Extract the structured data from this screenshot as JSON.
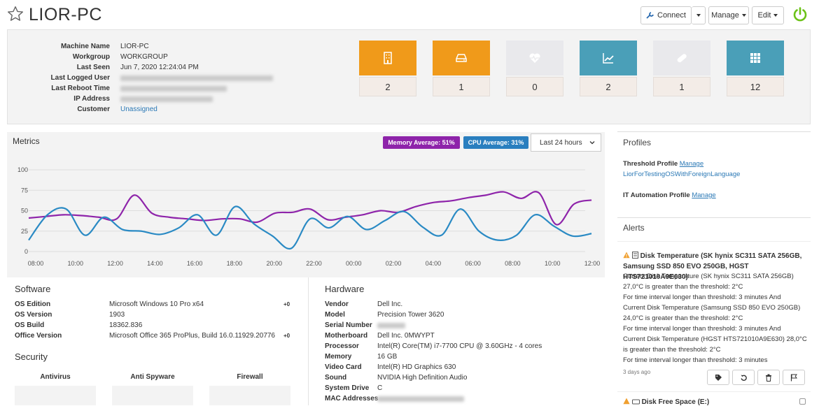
{
  "header": {
    "title": "LIOR-PC",
    "connect_label": "Connect",
    "manage_label": "Manage",
    "edit_label": "Edit"
  },
  "machine": {
    "rows": [
      {
        "label": "Machine Name",
        "value": "LIOR-PC"
      },
      {
        "label": "Workgroup",
        "value": "WORKGROUP"
      },
      {
        "label": "Last Seen",
        "value": "Jun 7, 2020 12:24:04 PM"
      },
      {
        "label": "Last Logged User",
        "value": ""
      },
      {
        "label": "Last Reboot Time",
        "value": ""
      },
      {
        "label": "IP Address",
        "value": ""
      },
      {
        "label": "Customer",
        "value": "Unassigned"
      }
    ]
  },
  "tiles": [
    {
      "icon": "building-icon",
      "count": "2",
      "color": "#f09a1a"
    },
    {
      "icon": "drive-icon",
      "count": "1",
      "color": "#f09a1a"
    },
    {
      "icon": "heartbeat-icon",
      "count": "0",
      "color": "#e9e9ec"
    },
    {
      "icon": "trend-chart-icon",
      "count": "2",
      "color": "#4a9fb8"
    },
    {
      "icon": "pill-icon",
      "count": "1",
      "color": "#e9e9ec"
    },
    {
      "icon": "grid-apps-icon",
      "count": "12",
      "color": "#4a9fb8"
    }
  ],
  "metrics": {
    "title": "Metrics",
    "memory_badge": "Memory Average: 51%",
    "cpu_badge": "CPU Average: 31%",
    "range_select": "Last 24 hours"
  },
  "chart_data": {
    "type": "line",
    "x": [
      "08:00",
      "10:00",
      "12:00",
      "14:00",
      "16:00",
      "18:00",
      "20:00",
      "22:00",
      "00:00",
      "02:00",
      "04:00",
      "06:00",
      "08:00",
      "10:00",
      "12:00"
    ],
    "ylim": [
      0,
      100
    ],
    "yticks": [
      0,
      25,
      50,
      75,
      100
    ],
    "series": [
      {
        "name": "Memory",
        "color": "#8e24aa",
        "values": [
          41,
          43,
          45,
          44,
          42,
          40,
          69,
          47,
          42,
          40,
          38,
          40,
          40,
          36,
          47,
          48,
          52,
          39,
          42,
          45,
          50,
          48,
          55,
          60,
          62,
          66,
          69,
          73,
          65,
          72,
          33,
          58,
          63
        ]
      },
      {
        "name": "CPU",
        "color": "#2a8ac4",
        "values": [
          14,
          45,
          52,
          20,
          42,
          27,
          25,
          21,
          29,
          45,
          20,
          55,
          34,
          19,
          4,
          40,
          29,
          43,
          27,
          38,
          49,
          30,
          20,
          52,
          25,
          14,
          20,
          45,
          31,
          19,
          22
        ]
      }
    ]
  },
  "software": {
    "title": "Software",
    "rows": [
      {
        "label": "OS Edition",
        "value": "Microsoft Windows 10 Pro x64",
        "tag": "+0"
      },
      {
        "label": "OS Version",
        "value": "1903",
        "tag": ""
      },
      {
        "label": "OS Build",
        "value": "18362.836",
        "tag": ""
      },
      {
        "label": "Office Version",
        "value": "Microsoft Office 365 ProPlus, Build 16.0.11929.20776",
        "tag": "+0"
      }
    ]
  },
  "security": {
    "title": "Security",
    "columns": [
      "Antivirus",
      "Anti Spyware",
      "Firewall"
    ]
  },
  "hardware": {
    "title": "Hardware",
    "rows": [
      {
        "label": "Vendor",
        "value": "Dell Inc."
      },
      {
        "label": "Model",
        "value": "Precision Tower 3620"
      },
      {
        "label": "Serial Number",
        "value": ""
      },
      {
        "label": "Motherboard",
        "value": "Dell Inc. 0MWYPT"
      },
      {
        "label": "Processor",
        "value": "Intel(R) Core(TM) i7-7700 CPU @ 3.60GHz - 4 cores"
      },
      {
        "label": "Memory",
        "value": "16 GB"
      },
      {
        "label": "Video Card",
        "value": "Intel(R) HD Graphics 630"
      },
      {
        "label": "Sound",
        "value": "NVIDIA High Definition Audio"
      },
      {
        "label": "System Drive",
        "value": "C"
      },
      {
        "label": "MAC Addresses",
        "value": ""
      }
    ]
  },
  "profiles": {
    "title": "Profiles",
    "threshold_label": "Threshold Profile",
    "threshold_manage": "Manage",
    "threshold_value": "LiorForTestingOSWithForeignLanguage",
    "automation_label": "IT Automation Profile",
    "automation_manage": "Manage"
  },
  "alerts": {
    "title": "Alerts",
    "items": [
      {
        "title": "Disk Temperature (SK hynix SC311 SATA 256GB, Samsung SSD 850 EVO 250GB, HGST HTS721010A9E630)",
        "lines": [
          "Current Disk Temperature (SK hynix SC311 SATA 256GB)",
          "27,0°C is greater than the threshold: 2°C",
          "For time interval longer than threshold: 3 minutes And",
          "Current Disk Temperature (Samsung SSD 850 EVO 250GB)",
          "24,0°C is greater than the threshold: 2°C",
          "For time interval longer than threshold: 3 minutes And",
          "Current Disk Temperature (HGST HTS721010A9E630) 28,0°C",
          "is greater than the threshold: 2°C",
          "For time interval longer than threshold: 3 minutes"
        ],
        "time": "3 days ago"
      },
      {
        "title": "Disk Free Space (E:)"
      }
    ]
  }
}
